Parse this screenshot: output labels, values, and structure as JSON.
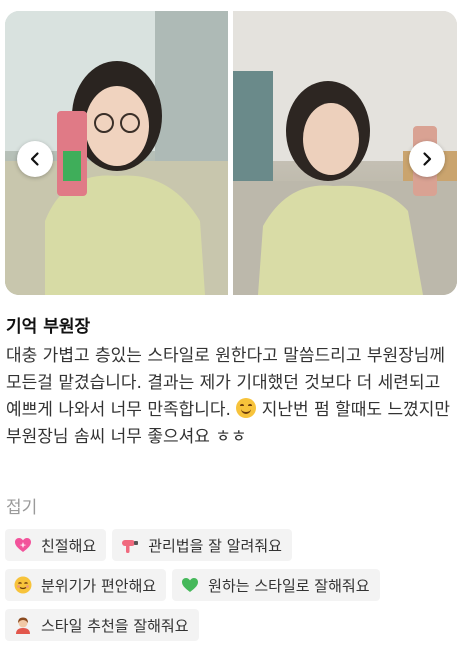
{
  "gallery": {
    "images": [
      {
        "icon": "woman-mirror-selfie-photo"
      },
      {
        "icon": "woman-salon-selfie-photo"
      }
    ],
    "prev_icon": "chevron-left-icon",
    "next_icon": "chevron-right-icon"
  },
  "review": {
    "author": "기억 부원장",
    "text_part1": "대충 가볍고 층있는 스타일로 원한다고 말씀드리고 부원장님께 모든걸 맡겼습니다. 결과는 제가 기대했던 것보다 더 세련되고 예쁘게 나와서 너무 만족합니다. ",
    "emoji": "smiling-face-icon",
    "text_part2": "지난번 펌 할때도 느꼈지만 부원장님 솜씨 너무 좋으셔요 ㅎㅎ",
    "collapse_label": "접기"
  },
  "tags": [
    {
      "label": "친절해요",
      "icon": "sparkling-heart-icon"
    },
    {
      "label": "관리법을 잘 알려줘요",
      "icon": "hair-dryer-icon"
    },
    {
      "label": "분위기가 편안해요",
      "icon": "relieved-face-icon"
    },
    {
      "label": "원하는 스타일로 잘해줘요",
      "icon": "green-heart-icon"
    },
    {
      "label": "스타일 추천을 잘해줘요",
      "icon": "person-getting-haircut-icon"
    }
  ],
  "colors": {
    "accent_pink": "#f2539b",
    "tag_bg": "#f3f3f3",
    "muted": "#9a9a9a"
  }
}
